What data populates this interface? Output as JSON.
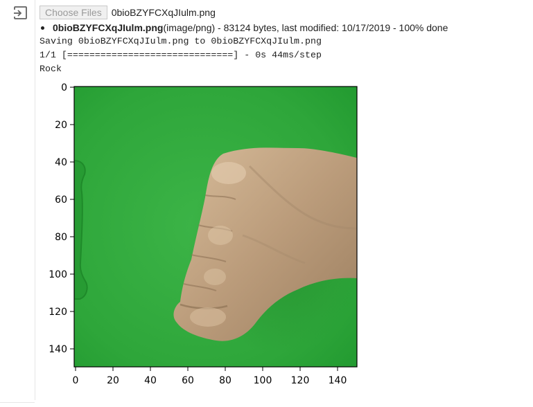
{
  "upload": {
    "button_label": "Choose Files",
    "selected_file": "0bioBZYFCXqJIulm.png",
    "file_name_bold": "0bioBZYFCXqJIulm.png",
    "file_details": "(image/png) - 83124 bytes, last modified: 10/17/2019 - 100% done"
  },
  "output": {
    "saving_line": "Saving 0bioBZYFCXqJIulm.png to 0bioBZYFCXqJIulm.png",
    "progress_line": "1/1 [==============================] - 0s 44ms/step",
    "prediction": "Rock"
  },
  "plot": {
    "x_ticks": [
      "0",
      "20",
      "40",
      "60",
      "80",
      "100",
      "120",
      "140"
    ],
    "y_ticks": [
      "0",
      "20",
      "40",
      "60",
      "80",
      "100",
      "120",
      "140"
    ],
    "image_subject": "fist on green background",
    "colors": {
      "background_green": "#2fa83a",
      "skin": "#b89a78"
    }
  },
  "icons": {
    "output_icon": "exit-output-icon"
  }
}
